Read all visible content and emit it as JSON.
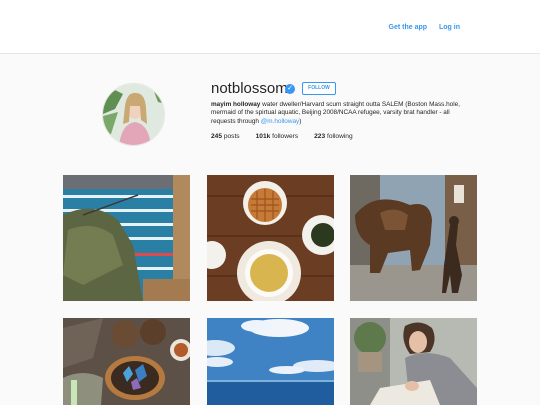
{
  "nav": {
    "get_app": "Get the app",
    "log_in": "Log in"
  },
  "profile": {
    "username": "notblossom",
    "verified_icon": "check-badge-icon",
    "follow_label": "FOLLOW",
    "full_name": "mayim holloway",
    "bio_text": " water dweller/Harvard scum straight outta SALEM (Boston Mass.hole, mermaid of the spirtual aquatic, Beijing 2008/NCAA refugee, varsity brat handler - all requests through ",
    "bio_mention": "@m.holloway",
    "bio_end": ")"
  },
  "stats": {
    "posts_count": "245",
    "posts_label": " posts",
    "followers_count": "101k",
    "followers_label": " followers",
    "following_count": "223",
    "following_label": " following"
  },
  "colors": {
    "accent": "#3897f0",
    "background": "#fafafa"
  }
}
